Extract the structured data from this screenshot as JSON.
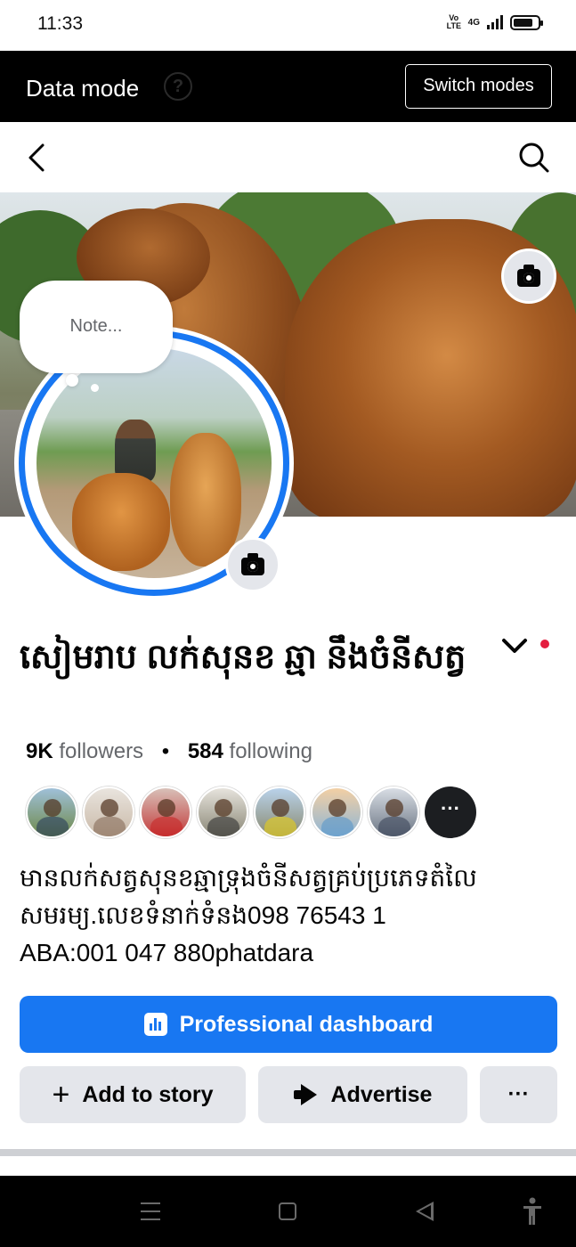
{
  "status_bar": {
    "time": "11:33",
    "volte_top": "Vo",
    "volte_bottom": "LTE",
    "network": "4G",
    "battery_level": 0.8,
    "icons": [
      "volte-icon",
      "signal-4g-icon",
      "battery-icon"
    ]
  },
  "data_mode": {
    "title": "Data mode",
    "help_glyph": "?",
    "switch_label": "Switch modes"
  },
  "nav": {
    "icons": [
      "back-arrow-icon",
      "search-icon"
    ]
  },
  "note": {
    "placeholder": "Note..."
  },
  "profile": {
    "name": "សៀមរាប លក់សុនខ ឆ្មា នឹងចំនីសត្វ",
    "followers_count": "9K",
    "followers_label": "followers",
    "separator": "•",
    "following_count": "584",
    "following_label": "following",
    "bio_line1": "មានលក់សត្វសុនខឆ្មាទ្រុងចំនីសត្វគ្រប់ប្រភេទតំលៃ",
    "bio_line2": "សមរម្យ.លេខទំនាក់ទំនង098 76543 1",
    "bio_line3": "ABA:001 047 880phatdara",
    "friends_more": "···"
  },
  "buttons": {
    "professional_dashboard": "Professional dashboard",
    "add_to_story": "Add to story",
    "add_glyph": "+",
    "advertise": "Advertise",
    "more": "···"
  },
  "colors": {
    "accent": "#1877f2",
    "notification_dot": "#e41e3f",
    "secondary_button": "#e4e6eb"
  }
}
